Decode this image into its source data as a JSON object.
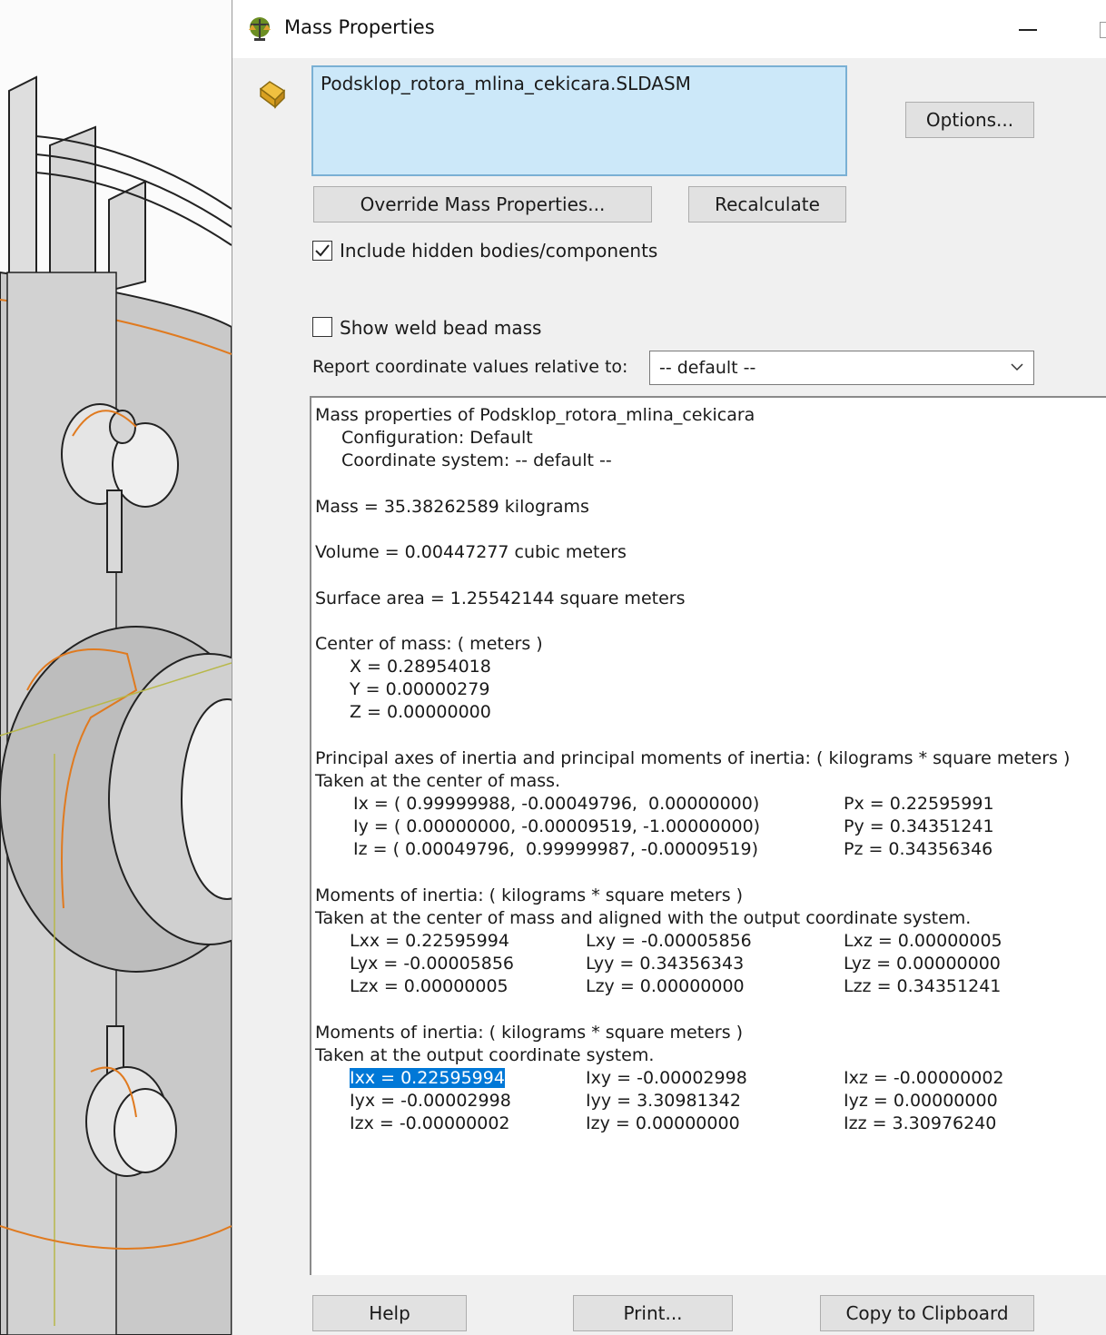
{
  "window": {
    "title": "Mass Properties",
    "icon": "balance-scale-icon"
  },
  "selection": {
    "value": "Podsklop_rotora_mlina_cekicara.SLDASM",
    "icon": "assembly-icon"
  },
  "buttons": {
    "options": "Options...",
    "override": "Override Mass Properties...",
    "recalculate": "Recalculate",
    "help": "Help",
    "print": "Print...",
    "copy": "Copy to Clipboard"
  },
  "checkboxes": {
    "hidden": {
      "label": "Include hidden bodies/components",
      "checked": true
    },
    "weld": {
      "label": "Show weld bead mass",
      "checked": false
    }
  },
  "report": {
    "label": "Report coordinate values relative to:",
    "selected": "-- default --"
  },
  "results": {
    "header": "Mass properties of Podsklop_rotora_mlina_cekicara",
    "configuration": "Configuration: Default",
    "coordinate_system": "Coordinate system: -- default --",
    "mass": "Mass = 35.38262589 kilograms",
    "volume": "Volume = 0.00447277 cubic meters",
    "surface_area": "Surface area = 1.25542144 square meters",
    "com": {
      "header": "Center of mass: ( meters )",
      "x": "X = 0.28954018",
      "y": "Y = 0.00000279",
      "z": "Z = 0.00000000"
    },
    "principal": {
      "header": "Principal axes of inertia and principal moments of inertia: ( kilograms * square meters )",
      "sub": "Taken at the center of mass.",
      "ix": "Ix = ( 0.99999988, -0.00049796,  0.00000000)",
      "iy": "Iy = ( 0.00000000, -0.00009519, -1.00000000)",
      "iz": "Iz = ( 0.00049796,  0.99999987, -0.00009519)",
      "px": "Px = 0.22595991",
      "py": "Py = 0.34351241",
      "pz": "Pz = 0.34356346"
    },
    "moi_com": {
      "header": "Moments of inertia: ( kilograms * square meters )",
      "sub": "Taken at the center of mass and aligned with the output coordinate system.",
      "lxx": "Lxx = 0.22595994",
      "lxy": "Lxy = -0.00005856",
      "lxz": "Lxz = 0.00000005",
      "lyx": "Lyx = -0.00005856",
      "lyy": "Lyy = 0.34356343",
      "lyz": "Lyz = 0.00000000",
      "lzx": "Lzx = 0.00000005",
      "lzy": "Lzy = 0.00000000",
      "lzz": "Lzz = 0.34351241"
    },
    "moi_out": {
      "header": "Moments of inertia: ( kilograms * square meters )",
      "sub": "Taken at the output coordinate system.",
      "ixx": "Ixx = 0.22595994",
      "ixy": "Ixy = -0.00002998",
      "ixz": "Ixz = -0.00000002",
      "iyx": "Iyx = -0.00002998",
      "iyy": "Iyy = 3.30981342",
      "iyz": "Iyz = 0.00000000",
      "izx": "Izx = -0.00000002",
      "izy": "Izy = 0.00000000",
      "izz": "Izz = 3.30976240"
    }
  },
  "colors": {
    "selection_bg": "#cce8f9",
    "highlight": "#0078d7",
    "dialog_bg": "#f0f0f0",
    "model_edge": "#e07a1f"
  }
}
